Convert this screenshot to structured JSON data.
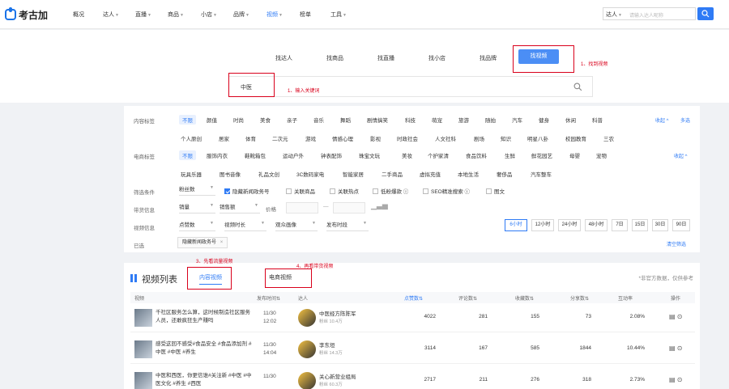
{
  "brand": {
    "logo_text": "考古加",
    "accent": "#2f7bf5",
    "annotation_color": "#d9001b"
  },
  "nav": {
    "items": [
      "概况",
      "达人",
      "直播",
      "商品",
      "小店",
      "品牌",
      "视频",
      "榜单",
      "工具"
    ],
    "active": "视频"
  },
  "search": {
    "select": "达人",
    "placeholder": "请输入达人昵称"
  },
  "search_tabs": [
    "找达人",
    "找商品",
    "找直播",
    "找小店",
    "找品牌",
    "找视频"
  ],
  "annotations": {
    "a1": "1、找到视频",
    "a2": "1、输入关键词",
    "a3": "3、先看流量视频",
    "a4": "4、再看带货视频"
  },
  "main_search": {
    "value": "中医"
  },
  "filters": {
    "content_tag_label": "内容标签",
    "content_tags_row1": [
      "不限",
      "颜值",
      "时尚",
      "美食",
      "亲子",
      "音乐",
      "舞蹈",
      "剧情搞笑",
      "科技",
      "萌宠",
      "旅游",
      "随拍",
      "汽车",
      "健身",
      "休闲",
      "科普"
    ],
    "content_tags_row2": [
      "个人原创",
      "居家",
      "体育",
      "二次元",
      "游戏",
      "情感心理",
      "影视",
      "时政社会",
      "人文社科",
      "剧场",
      "知识",
      "明星八卦",
      "校园教育",
      "三农"
    ],
    "collapse": "收起 ^",
    "multi": "多选",
    "ecom_tag_label": "电商标签",
    "ecom_tags_row1": [
      "不限",
      "服饰内衣",
      "鞋靴箱包",
      "运动户外",
      "钟表配饰",
      "珠宝文玩",
      "美妆",
      "个护家清",
      "食品饮料",
      "生鲜",
      "鲜花园艺",
      "母婴",
      "宠物"
    ],
    "ecom_tags_row2": [
      "玩具乐器",
      "图书音像",
      "礼品文创",
      "3C数码家电",
      "智能家居",
      "二手商品",
      "虚拟充值",
      "本地生活",
      "奢侈品",
      "汽车整车"
    ],
    "ecom_collapse": "收起 ^",
    "screen_label": "筛选条件",
    "screen_dd": "粉丝数",
    "checks": [
      {
        "label": "隐藏新闻政务号",
        "checked": true
      },
      {
        "label": "关联商品",
        "checked": false
      },
      {
        "label": "关联热点",
        "checked": false
      },
      {
        "label": "低粉爆款 ⓘ",
        "checked": false
      },
      {
        "label": "SEO精准搜索 ⓘ",
        "checked": false
      },
      {
        "label": "图文",
        "checked": false
      }
    ],
    "goods_label": "带货信息",
    "goods_dd1": "销量",
    "goods_dd2": "销售额",
    "price_label": "价格",
    "video_label": "视频信息",
    "video_dd": [
      "点赞数",
      "视频时长",
      "观众画像",
      "发布时段"
    ],
    "time_buttons": [
      "6小时",
      "12小时",
      "24小时",
      "48小时",
      "7日",
      "15日",
      "30日",
      "90日"
    ],
    "time_active": "6小时",
    "selected_label": "已选",
    "selected_tag": "隐藏新闻政务号",
    "clear": "清空筛选"
  },
  "list": {
    "title": "视频列表",
    "tabs": [
      "内容视频",
      "电商视频"
    ],
    "active_tab": "内容视频",
    "note": "*非官方数据，仅供参考",
    "columns": [
      "视频",
      "发布时间",
      "达人",
      "点赞数",
      "评论数",
      "收藏数",
      "分享数",
      "互动率",
      "操作"
    ],
    "rows": [
      {
        "title": "千社区服务怎么算，这时候制造社区服务人员，还敢疯狂生产赚吗",
        "date": "11/30",
        "time": "12:02",
        "author": "中医经方陈陈军",
        "fans": "粉丝 10.4万",
        "likes": "4022",
        "comments": "281",
        "collects": "155",
        "shares": "73",
        "rate": "2.08%"
      },
      {
        "title": "感受这回不感受#食品安全 #食品添加剂 #中医 #中医 #养生",
        "date": "11/30",
        "time": "14:04",
        "author": "李东垣",
        "fans": "粉丝 14.3万",
        "likes": "3114",
        "comments": "167",
        "collects": "585",
        "shares": "1844",
        "rate": "10.44%"
      },
      {
        "title": "中医和西医，你更信谁#关注新 #中医 #中医文化 #养生 #西医",
        "date": "11/30",
        "time": "",
        "author": "关心新营业组局",
        "fans": "粉丝 60.3万",
        "likes": "2717",
        "comments": "211",
        "collects": "276",
        "shares": "318",
        "rate": "2.73%"
      }
    ]
  }
}
